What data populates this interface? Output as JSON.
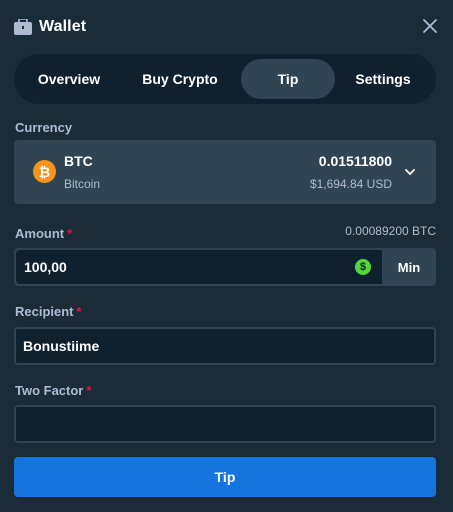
{
  "header": {
    "title": "Wallet",
    "icon": "wallet-icon",
    "close_icon": "close-icon"
  },
  "tabs": [
    {
      "label": "Overview",
      "active": false
    },
    {
      "label": "Buy Crypto",
      "active": false
    },
    {
      "label": "Tip",
      "active": true
    },
    {
      "label": "Settings",
      "active": false
    }
  ],
  "currency": {
    "label": "Currency",
    "code": "BTC",
    "name": "Bitcoin",
    "symbol": "₿",
    "balance": "0.01511800",
    "usd": "$1,694.84 USD"
  },
  "amount": {
    "label": "Amount",
    "required": "*",
    "crypto_value": "0.00089200 BTC",
    "value": "100,00",
    "currency_symbol": "$",
    "min_label": "Min"
  },
  "recipient": {
    "label": "Recipient",
    "required": "*",
    "value": "Bonustiime"
  },
  "two_factor": {
    "label": "Two Factor",
    "required": "*",
    "value": ""
  },
  "submit": {
    "label": "Tip"
  },
  "colors": {
    "background": "#1a2c38",
    "panel_dark": "#0f212e",
    "panel_light": "#2f4553",
    "accent_blue": "#1475e1",
    "bitcoin_orange": "#f7931a",
    "usd_green": "#55d63b",
    "required_red": "#e9113c",
    "muted_text": "#b1bad3"
  }
}
